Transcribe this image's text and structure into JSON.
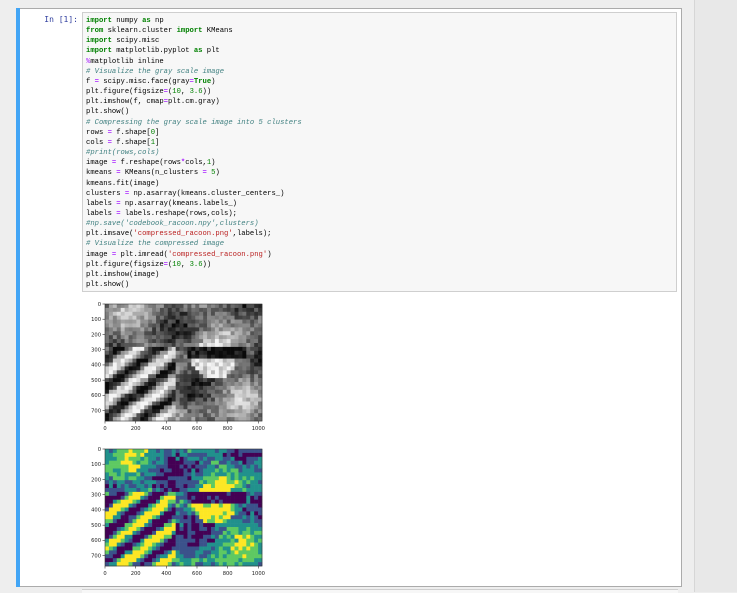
{
  "prompt": "In [1]:",
  "code_lines": [
    "import numpy as np",
    "from sklearn.cluster import KMeans",
    "import scipy.misc",
    "import matplotlib.pyplot as plt",
    "%matplotlib inline",
    "# Visualize the gray scale image",
    "f = scipy.misc.face(gray=True)",
    "plt.figure(figsize=(10, 3.6))",
    "plt.imshow(f, cmap=plt.cm.gray)",
    "plt.show()",
    "# Compressing the gray scale image into 5 clusters",
    "rows = f.shape[0]",
    "cols = f.shape[1]",
    "#print(rows,cols)",
    "image = f.reshape(rows*cols,1)",
    "kmeans = KMeans(n_clusters = 5)",
    "kmeans.fit(image)",
    "clusters = np.asarray(kmeans.cluster_centers_)",
    "labels = np.asarray(kmeans.labels_)",
    "labels = labels.reshape(rows,cols);",
    "#np.save('codebook_racoon.npy',clusters)",
    "plt.imsave('compressed_racoon.png',labels);",
    "# Visualize the compressed image",
    "image = plt.imread('compressed_racoon.png')",
    "plt.figure(figsize=(10, 3.6))",
    "plt.imshow(image)",
    "plt.show()"
  ],
  "plots": [
    {
      "image": "grayscale raccoon face",
      "xticks": [
        "0",
        "200",
        "400",
        "600",
        "800",
        "1000"
      ],
      "yticks": [
        "0",
        "100",
        "200",
        "300",
        "400",
        "500",
        "600",
        "700"
      ]
    },
    {
      "image": "5-cluster compressed raccoon (viridis colors)",
      "xticks": [
        "0",
        "200",
        "400",
        "600",
        "800",
        "1000"
      ],
      "yticks": [
        "0",
        "100",
        "200",
        "300",
        "400",
        "500",
        "600",
        "700"
      ]
    }
  ],
  "colors": {
    "cell_selected_bar": "#42a5f5",
    "prompt": "#303f9f",
    "cluster_palette": [
      "#440154",
      "#3b528b",
      "#21918c",
      "#5ec962",
      "#fde725"
    ]
  }
}
